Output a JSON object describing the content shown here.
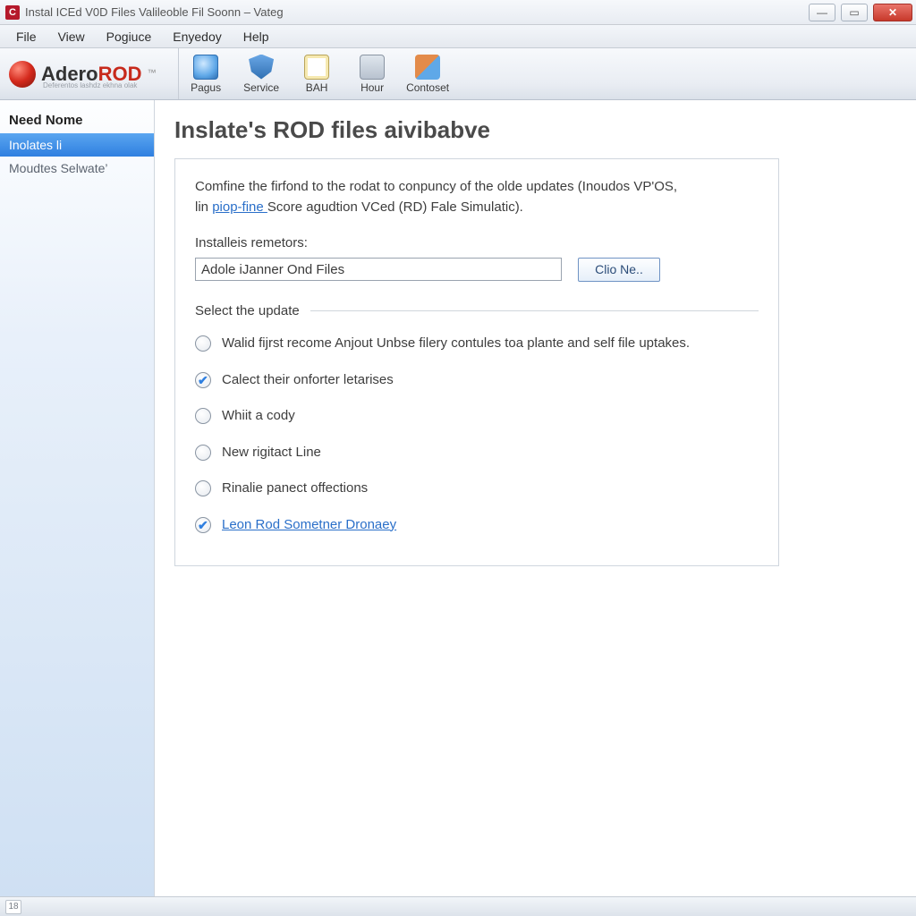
{
  "titlebar": {
    "app_icon_letter": "C",
    "title": "Instal ICEd V0D Files Valileoble Fil Soonn – Vateg"
  },
  "menubar": [
    "File",
    "View",
    "Pogiuce",
    "Enyedoy",
    "Help"
  ],
  "logo": {
    "brand_left": "Adero",
    "brand_right": "ROD",
    "tm": "™",
    "sub": "Deferentos lashdz ekhna olak"
  },
  "toolbar_buttons": [
    {
      "label": "Pagus",
      "icon": "globe"
    },
    {
      "label": "Service",
      "icon": "shield"
    },
    {
      "label": "BAH",
      "icon": "doc"
    },
    {
      "label": "Hour",
      "icon": "printer"
    },
    {
      "label": "Contoset",
      "icon": "windows"
    }
  ],
  "sidebar": {
    "header": "Need Nome",
    "items": [
      {
        "label": "Inolates li",
        "selected": true
      },
      {
        "label": "Moudtes Selwate’",
        "selected": false
      }
    ]
  },
  "page": {
    "title": "Inslate's ROD files aivibabve",
    "intro_1": "Comfine the firfond to the rodat to conpuncy of the olde updates (Inoudos VP'OS,",
    "intro_2a": "lin ",
    "intro_link": "piop-fine ",
    "intro_2b": "Score agudtion VCed (RD) Fale Simulatic).",
    "field_label": "Installeis remetors:",
    "field_value": "Adole iJanner Ond Files",
    "browse_btn": "Clio Ne..",
    "section": "Select the update",
    "options": [
      {
        "label": "Walid fijrst recome Anjout Unbse filery contules toa plante and self file uptakes.",
        "checked": false,
        "link": false
      },
      {
        "label": "Calect their onforter letarises",
        "checked": true,
        "link": false
      },
      {
        "label": "Whiit a cody",
        "checked": false,
        "link": false
      },
      {
        "label": "New rigitact Line",
        "checked": false,
        "link": false
      },
      {
        "label": "Rinalie panect offections",
        "checked": false,
        "link": false
      },
      {
        "label": "Leon Rod Sometner Dronaey",
        "checked": true,
        "link": true
      }
    ]
  },
  "statusbar": {
    "text": "18"
  }
}
